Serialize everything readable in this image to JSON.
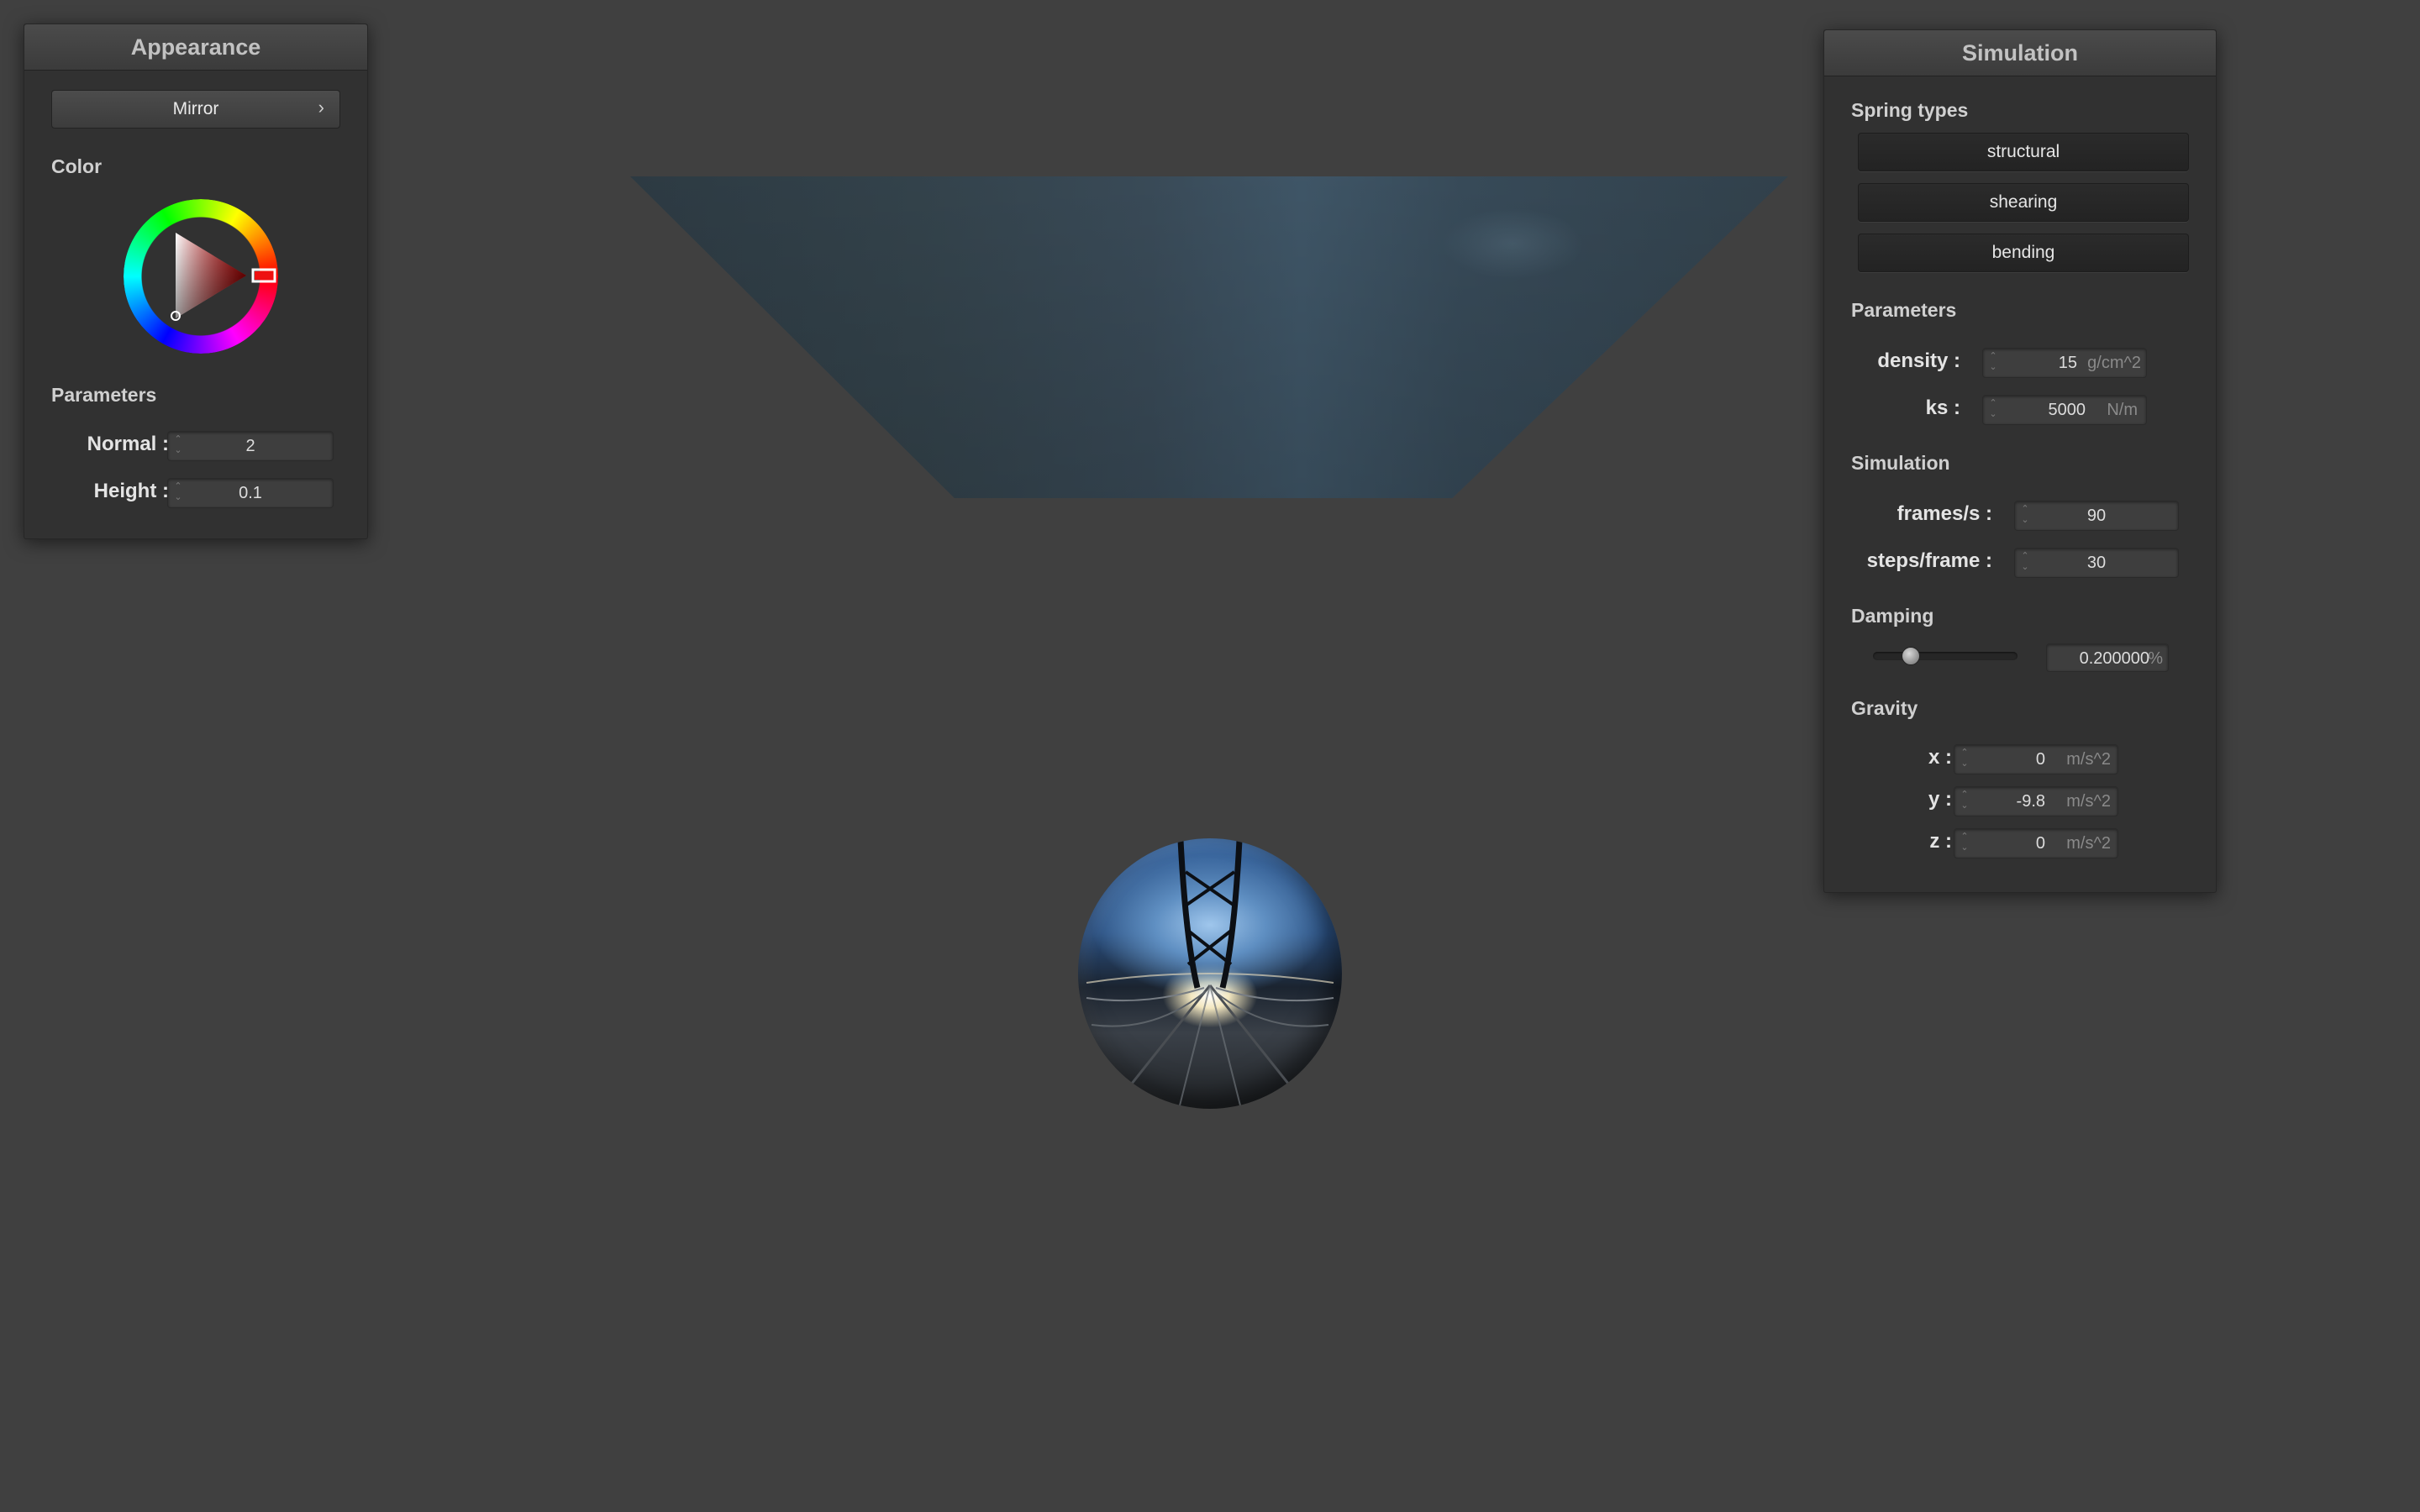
{
  "appearance": {
    "title": "Appearance",
    "material_button": "Mirror",
    "chevron": "›",
    "color_section": "Color",
    "color_value": "#cc2a2a",
    "params_section": "Parameters",
    "normal_label": "Normal :",
    "normal_value": "2",
    "height_label": "Height :",
    "height_value": "0.1"
  },
  "simulation": {
    "title": "Simulation",
    "spring_section": "Spring types",
    "spring_buttons": [
      "structural",
      "shearing",
      "bending"
    ],
    "params_section": "Parameters",
    "density_label": "density :",
    "density_value": "15",
    "density_unit": "g/cm^2",
    "ks_label": "ks :",
    "ks_value": "5000",
    "ks_unit": "N/m",
    "sim_section": "Simulation",
    "fps_label": "frames/s :",
    "fps_value": "90",
    "steps_label": "steps/frame :",
    "steps_value": "30",
    "damping_section": "Damping",
    "damping_value": "0.200000",
    "damping_unit": "%",
    "damping_fraction": 0.2,
    "gravity_section": "Gravity",
    "gx_label": "x :",
    "gx_value": "0",
    "gy_label": "y :",
    "gy_value": "-9.8",
    "gz_label": "z :",
    "gz_value": "0",
    "gravity_unit": "m/s^2"
  },
  "icons": {
    "spin_arrows": "⌃⌄"
  }
}
